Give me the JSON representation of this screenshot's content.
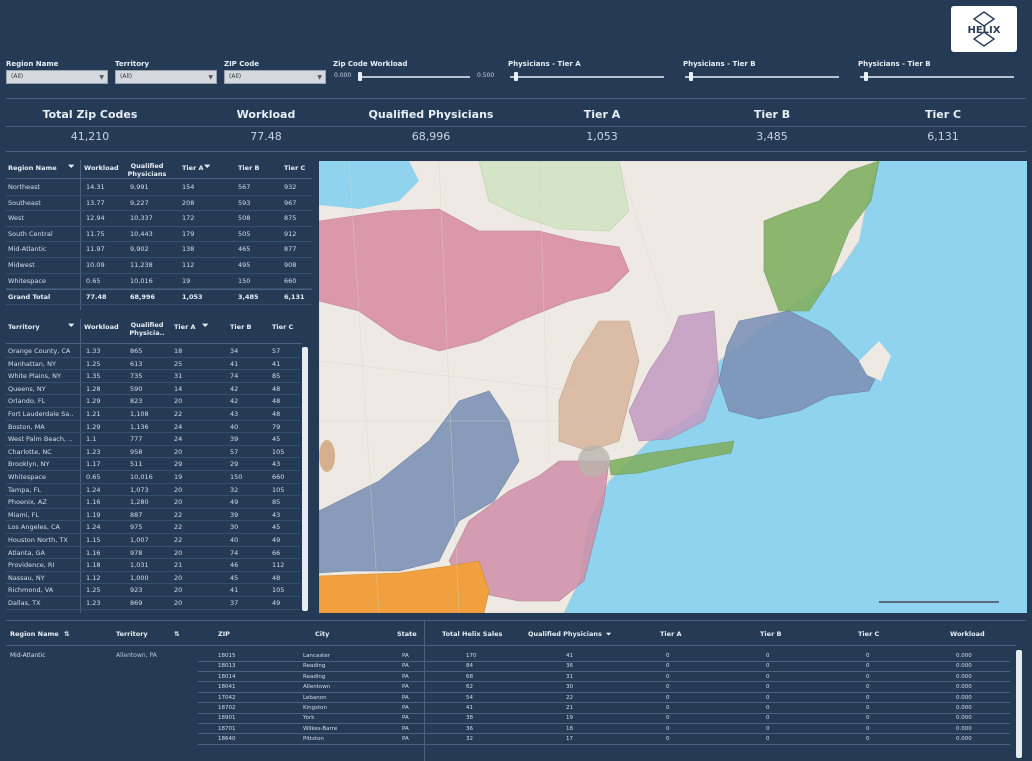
{
  "logo": {
    "text": "HELIX"
  },
  "filters": [
    {
      "label": "Region Name",
      "value": "(All)",
      "kind": "select"
    },
    {
      "label": "Territory",
      "value": "(All)",
      "kind": "select"
    },
    {
      "label": "ZIP Code",
      "value": "(All)",
      "kind": "select"
    },
    {
      "label": "Zip Code Workload",
      "min": "0.000",
      "max": "0.500",
      "kind": "slider"
    },
    {
      "label": "Physicians - Tier A",
      "kind": "slider"
    },
    {
      "label": "Physicians - Tier B",
      "kind": "slider"
    },
    {
      "label": "Physicians - Tier B",
      "kind": "slider"
    }
  ],
  "kpis": [
    {
      "label": "Total Zip Codes",
      "value": "41,210"
    },
    {
      "label": "Workload",
      "value": "77.48"
    },
    {
      "label": "Qualified Physicians",
      "value": "68,996"
    },
    {
      "label": "Tier A",
      "value": "1,053"
    },
    {
      "label": "Tier B",
      "value": "3,485"
    },
    {
      "label": "Tier C",
      "value": "6,131"
    }
  ],
  "region_table": {
    "headers": [
      "Region Name",
      "Workload",
      "Qualified Physicians",
      "Tier A",
      "Tier B",
      "Tier C"
    ],
    "rows": [
      [
        "Northeast",
        "14.31",
        "9,991",
        "154",
        "567",
        "932"
      ],
      [
        "Southeast",
        "13.77",
        "9,227",
        "208",
        "593",
        "967"
      ],
      [
        "West",
        "12.94",
        "10,337",
        "172",
        "508",
        "875"
      ],
      [
        "South Central",
        "11.75",
        "10,443",
        "179",
        "505",
        "912"
      ],
      [
        "Mid-Atlantic",
        "11.97",
        "9,902",
        "138",
        "465",
        "877"
      ],
      [
        "Midwest",
        "10.09",
        "11,238",
        "112",
        "495",
        "908"
      ],
      [
        "Whitespace",
        "0.65",
        "10,016",
        "19",
        "150",
        "660"
      ]
    ],
    "total": [
      "Grand Total",
      "77.48",
      "68,996",
      "1,053",
      "3,485",
      "6,131"
    ]
  },
  "territory_table": {
    "headers": [
      "Territory",
      "Workload",
      "Qualified Physicia..",
      "Tier A",
      "Tier B",
      "Tier C"
    ],
    "rows": [
      [
        "Orange County, CA",
        "1.33",
        "865",
        "18",
        "34",
        "57"
      ],
      [
        "Manhattan, NY",
        "1.25",
        "613",
        "25",
        "41",
        "41"
      ],
      [
        "White Plains, NY",
        "1.35",
        "735",
        "31",
        "74",
        "85"
      ],
      [
        "Queens, NY",
        "1.28",
        "590",
        "14",
        "42",
        "48"
      ],
      [
        "Orlando, FL",
        "1.29",
        "823",
        "20",
        "42",
        "48"
      ],
      [
        "Fort Lauderdale Sa..",
        "1.21",
        "1,108",
        "22",
        "43",
        "48"
      ],
      [
        "Boston, MA",
        "1.29",
        "1,136",
        "24",
        "40",
        "79"
      ],
      [
        "West Palm Beach, ..",
        "1.1",
        "777",
        "24",
        "39",
        "45"
      ],
      [
        "Charlotte, NC",
        "1.23",
        "958",
        "20",
        "57",
        "105"
      ],
      [
        "Brooklyn, NY",
        "1.17",
        "511",
        "29",
        "29",
        "43"
      ],
      [
        "Whitespace",
        "0.65",
        "10,016",
        "19",
        "150",
        "660"
      ],
      [
        "Tampa, FL",
        "1.24",
        "1,073",
        "20",
        "32",
        "105"
      ],
      [
        "Phoenix, AZ",
        "1.16",
        "1,280",
        "20",
        "49",
        "85"
      ],
      [
        "Miami, FL",
        "1.19",
        "887",
        "22",
        "39",
        "43"
      ],
      [
        "Los Angeles, CA",
        "1.24",
        "975",
        "22",
        "30",
        "45"
      ],
      [
        "Houston North, TX",
        "1.15",
        "1,007",
        "22",
        "40",
        "49"
      ],
      [
        "Atlanta, GA",
        "1.16",
        "978",
        "20",
        "74",
        "66"
      ],
      [
        "Providence, RI",
        "1.18",
        "1,031",
        "21",
        "46",
        "112"
      ],
      [
        "Nassau, NY",
        "1.12",
        "1,000",
        "20",
        "45",
        "48"
      ],
      [
        "Richmond, VA",
        "1.25",
        "923",
        "20",
        "41",
        "105"
      ],
      [
        "Dallas, TX",
        "1.23",
        "869",
        "20",
        "37",
        "49"
      ]
    ]
  },
  "map": {
    "water": "#8fd3ef",
    "land": "#eeeae3"
  },
  "detail_table": {
    "headers": [
      "Region Name",
      "Territory",
      "ZIP",
      "City",
      "State",
      "Total Helix Sales",
      "Qualified Physicians",
      "Tier A",
      "Tier B",
      "Tier C",
      "Workload"
    ],
    "region": "Mid-Atlantic",
    "territory": "Allentown, PA",
    "rows": [
      [
        "18015",
        "Lancaster",
        "PA",
        "170",
        "41",
        "0",
        "0",
        "0",
        "0.000"
      ],
      [
        "18013",
        "Reading",
        "PA",
        "84",
        "36",
        "0",
        "0",
        "0",
        "0.000"
      ],
      [
        "18014",
        "Reading",
        "PA",
        "68",
        "31",
        "0",
        "0",
        "0",
        "0.000"
      ],
      [
        "18041",
        "Allentown",
        "PA",
        "62",
        "30",
        "0",
        "0",
        "0",
        "0.000"
      ],
      [
        "17042",
        "Lebanon",
        "PA",
        "54",
        "22",
        "0",
        "0",
        "0",
        "0.000"
      ],
      [
        "18702",
        "Kingston",
        "PA",
        "41",
        "21",
        "0",
        "0",
        "0",
        "0.000"
      ],
      [
        "18901",
        "York",
        "PA",
        "38",
        "19",
        "0",
        "0",
        "0",
        "0.000"
      ],
      [
        "18701",
        "Wilkes-Barre",
        "PA",
        "36",
        "18",
        "0",
        "0",
        "0",
        "0.000"
      ],
      [
        "18640",
        "Pittston",
        "PA",
        "32",
        "17",
        "0",
        "0",
        "0",
        "0.000"
      ]
    ]
  }
}
